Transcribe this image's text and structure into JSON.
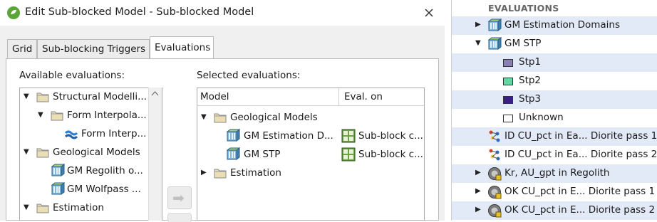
{
  "window": {
    "title": "Edit Sub-blocked Model - Sub-blocked Model",
    "close_glyph": "✕"
  },
  "tabs": [
    {
      "label": "Grid",
      "active": false
    },
    {
      "label": "Sub-blocking Triggers",
      "active": false
    },
    {
      "label": "Evaluations",
      "active": true
    }
  ],
  "available": {
    "label": "Available evaluations:",
    "items": [
      {
        "text": "Structural Modelli...",
        "icon": "folder-icon",
        "expanded": true
      },
      {
        "text": "Form Interpola...",
        "icon": "folder-icon",
        "expanded": true
      },
      {
        "text": "Form Interp...",
        "icon": "interpolant-icon"
      },
      {
        "text": "Geological Models",
        "icon": "folder-icon",
        "expanded": true
      },
      {
        "text": "GM Regolith o...",
        "icon": "geomodel-icon"
      },
      {
        "text": "GM Wolfpass ...",
        "icon": "geomodel-icon"
      },
      {
        "text": "Estimation",
        "icon": "folder-icon",
        "expanded": true
      }
    ]
  },
  "selected": {
    "label": "Selected evaluations:",
    "columns": [
      "Model",
      "Eval. on"
    ],
    "rows": [
      {
        "model": "Geological Models",
        "eval_on": "",
        "icon": "folder-icon",
        "expanded": true
      },
      {
        "model": "GM Estimation D...",
        "eval_on": "Sub-block c...",
        "icon": "geomodel-icon"
      },
      {
        "model": "GM STP",
        "eval_on": "Sub-block c...",
        "icon": "geomodel-icon"
      },
      {
        "model": "Estimation",
        "eval_on": "",
        "icon": "folder-icon",
        "expanded": false
      }
    ]
  },
  "add_button_glyph": "➡",
  "evaluations_panel": {
    "heading": "EVALUATIONS",
    "items": [
      {
        "text": "GM Estimation Domains",
        "expander": "▶",
        "icon": "geomodel-icon",
        "selected": true
      },
      {
        "text": "GM STP",
        "expander": "▼",
        "icon": "geomodel-icon",
        "selected": false
      },
      {
        "text": "Stp1",
        "swatch": "#8a7fb3",
        "selected": true
      },
      {
        "text": "Stp2",
        "swatch": "#5fd9a0",
        "selected": false
      },
      {
        "text": "Stp3",
        "swatch": "#3a1f86",
        "selected": true
      },
      {
        "text": "Unknown",
        "swatch": "#ffffff",
        "selected": false
      },
      {
        "text": "ID CU_pct in Ea... Diorite pass 1",
        "icon": "estimator-icon",
        "selected": true
      },
      {
        "text": "ID CU_pct in Ea... Diorite pass 2",
        "icon": "estimator-icon",
        "selected": false
      },
      {
        "text": "Kr, AU_gpt in Regolith",
        "expander": "▶",
        "icon": "kriging-icon",
        "selected": true
      },
      {
        "text": "OK CU_pct in E... Diorite pass 1",
        "expander": "▶",
        "icon": "kriging-icon",
        "selected": false
      },
      {
        "text": "OK CU_pct in E... Diorite pass 2",
        "expander": "▶",
        "icon": "kriging-icon",
        "selected": true
      }
    ]
  },
  "colors": {
    "accent_green": "#5aa536",
    "selection_blue": "#e3eaf7",
    "folder": "#e8d9a4"
  }
}
